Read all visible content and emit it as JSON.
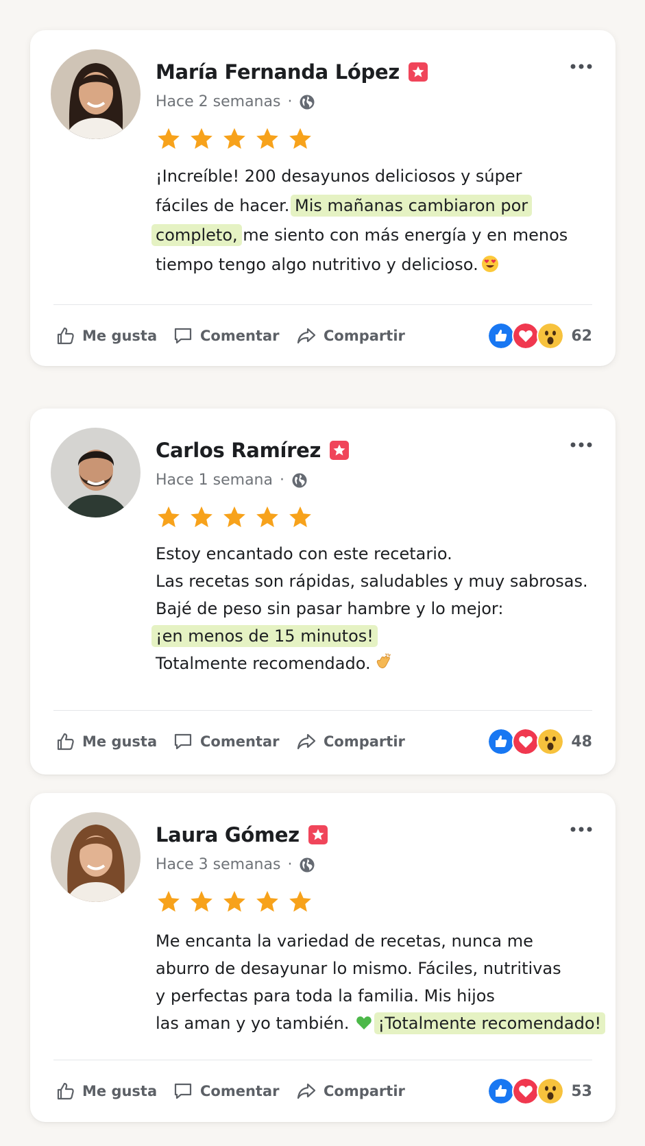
{
  "reviews": [
    {
      "name": "María Fernanda López",
      "time": "Hace 2 semanas",
      "dot": "·",
      "rating": 5,
      "avatar": "woman-dark-hair-avatar",
      "text": {
        "l1": "¡Increíble! 200 desayunos deliciosos y súper",
        "l2a": "fáciles de hacer.",
        "l2b": "Mis mañanas cambiaron por",
        "l3a": "completo,",
        "l3b": "me siento con más energía y en menos",
        "l4": "tiempo tengo algo nutritivo y delicioso."
      },
      "emoji": "heart-eyes-emoji",
      "actions": {
        "like": "Me gusta",
        "comment": "Comentar",
        "share": "Compartir"
      },
      "reaction_count": "62"
    },
    {
      "name": "Carlos Ramírez",
      "time": "Hace 1 semana",
      "dot": "·",
      "rating": 5,
      "avatar": "man-beard-avatar",
      "text": {
        "l1": "Estoy encantado con este recetario.",
        "l2": "Las recetas son rápidas, saludables y muy sabrosas.",
        "l3": "Bajé de peso sin pasar hambre y lo mejor:",
        "l4": "¡en menos de 15 minutos!",
        "l5": "Totalmente recomendado."
      },
      "emoji": "clapping-hands-emoji",
      "actions": {
        "like": "Me gusta",
        "comment": "Comentar",
        "share": "Compartir"
      },
      "reaction_count": "48"
    },
    {
      "name": "Laura Gómez",
      "time": "Hace 3 semanas",
      "dot": "·",
      "rating": 5,
      "avatar": "woman-brown-hair-avatar",
      "text": {
        "l1": "Me encanta la variedad de recetas, nunca me",
        "l2": "aburro de desayunar lo mismo. Fáciles, nutritivas",
        "l3": "y perfectas para toda la familia. Mis hijos",
        "l4a": "las aman y yo también.",
        "l4b": "¡Totalmente recomendado!"
      },
      "emoji": "green-heart-emoji",
      "actions": {
        "like": "Me gusta",
        "comment": "Comentar",
        "share": "Compartir"
      },
      "reaction_count": "53"
    }
  ],
  "colors": {
    "star": "#f7a21b",
    "highlight": "#e5f2c3",
    "badge": "#f0455a",
    "like": "#1877f2",
    "love": "#f0384f",
    "wow": "#f7c23d"
  }
}
